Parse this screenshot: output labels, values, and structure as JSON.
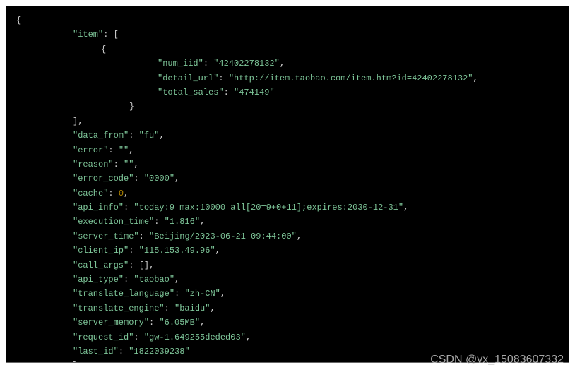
{
  "code": {
    "open_brace": "{",
    "item_key": "\"item\"",
    "item_open": ": [",
    "obj_open": "{",
    "num_iid_key": "\"num_iid\"",
    "num_iid_val": "\"42402278132\"",
    "detail_url_key": "\"detail_url\"",
    "detail_url_val": "\"http://item.taobao.com/item.htm?id=42402278132\"",
    "total_sales_key": "\"total_sales\"",
    "total_sales_val": "\"474149\"",
    "obj_close": "}",
    "arr_close": "],",
    "data_from_key": "\"data_from\"",
    "data_from_val": "\"fu\"",
    "error_key": "\"error\"",
    "error_val": "\"\"",
    "reason_key": "\"reason\"",
    "reason_val": "\"\"",
    "error_code_key": "\"error_code\"",
    "error_code_val": "\"0000\"",
    "cache_key": "\"cache\"",
    "cache_val": "0",
    "api_info_key": "\"api_info\"",
    "api_info_val": "\"today:9 max:10000 all[20=9+0+11];expires:2030-12-31\"",
    "execution_time_key": "\"execution_time\"",
    "execution_time_val": "\"1.816\"",
    "server_time_key": "\"server_time\"",
    "server_time_val": "\"Beijing/2023-06-21 09:44:00\"",
    "client_ip_key": "\"client_ip\"",
    "client_ip_val": "\"115.153.49.96\"",
    "call_args_key": "\"call_args\"",
    "call_args_val": "[]",
    "api_type_key": "\"api_type\"",
    "api_type_val": "\"taobao\"",
    "translate_language_key": "\"translate_language\"",
    "translate_language_val": "\"zh-CN\"",
    "translate_engine_key": "\"translate_engine\"",
    "translate_engine_val": "\"baidu\"",
    "server_memory_key": "\"server_memory\"",
    "server_memory_val": "\"6.05MB\"",
    "request_id_key": "\"request_id\"",
    "request_id_val": "\"gw-1.649255deded03\"",
    "last_id_key": "\"last_id\"",
    "last_id_val": "\"1822039238\"",
    "close_brace": "}",
    "colon": ": ",
    "comma": ","
  },
  "watermark": "CSDN @vx_15083607332"
}
